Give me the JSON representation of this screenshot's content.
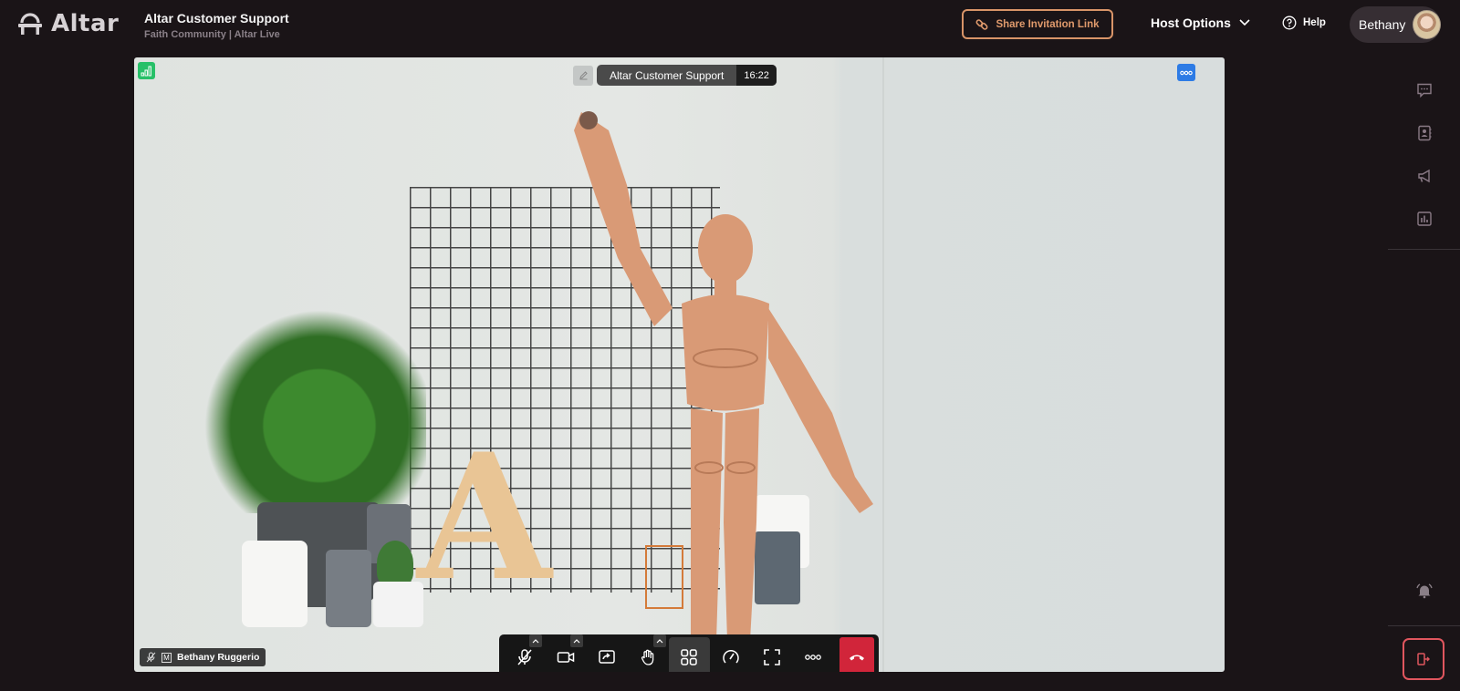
{
  "header": {
    "logo_text": "Altar",
    "title": "Altar Customer Support",
    "subtitle": "Faith Community | Altar Live",
    "share_label": "Share Invitation Link",
    "host_options_label": "Host Options",
    "help_label": "Help",
    "user_name": "Bethany"
  },
  "video": {
    "meeting_name": "Altar Customer Support",
    "elapsed_time": "16:22",
    "participant_name": "Bethany Ruggerio",
    "participant_badge": "M",
    "signal_icon": "signal-bars-icon",
    "more_icon": "more-horizontal-icon"
  },
  "toolbar": {
    "buttons": [
      {
        "name": "mute",
        "icon": "mic-off-icon",
        "has_caret": true
      },
      {
        "name": "camera",
        "icon": "video-camera-icon",
        "has_caret": true
      },
      {
        "name": "share-screen",
        "icon": "share-screen-icon",
        "has_caret": false
      },
      {
        "name": "raise-hand",
        "icon": "hand-icon",
        "has_caret": true
      },
      {
        "name": "layout",
        "icon": "grid-icon",
        "has_caret": false,
        "active": true
      },
      {
        "name": "stats",
        "icon": "speedometer-icon",
        "has_caret": false
      },
      {
        "name": "fullscreen",
        "icon": "fullscreen-icon",
        "has_caret": false
      },
      {
        "name": "more",
        "icon": "more-horizontal-icon",
        "has_caret": false
      },
      {
        "name": "end-call",
        "icon": "phone-hangup-icon",
        "has_caret": false
      }
    ],
    "end_color": "#d1253a"
  },
  "sidebar": {
    "items": [
      {
        "name": "chat",
        "icon": "chat-icon"
      },
      {
        "name": "participants",
        "icon": "contact-book-icon"
      },
      {
        "name": "announcements",
        "icon": "megaphone-icon"
      },
      {
        "name": "polls",
        "icon": "bar-chart-icon"
      },
      {
        "name": "notifications",
        "icon": "bell-ringing-icon"
      },
      {
        "name": "leave",
        "icon": "exit-door-icon"
      }
    ]
  },
  "colors": {
    "background": "#1a1417",
    "accent_orange": "#d89468",
    "signal_green": "#27c068",
    "more_blue": "#2d7be5",
    "leave_red": "#e0565e"
  }
}
